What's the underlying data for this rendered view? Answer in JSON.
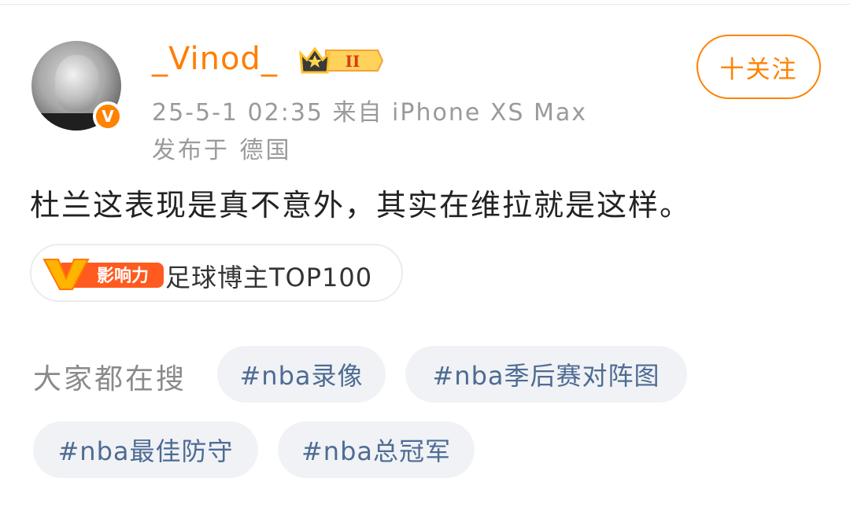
{
  "post": {
    "author": {
      "username": "_Vinod_",
      "verified_badge": "V",
      "rank_badge": "II"
    },
    "meta": "25-5-1 02:35  来自 iPhone XS Max",
    "location": "发布于 德国",
    "follow_label": "十关注",
    "text": "杜兰这表现是真不意外，其实在维拉就是这样。",
    "influence": {
      "logo_text": "影响力",
      "label": "足球博主TOP100"
    }
  },
  "search": {
    "label": "大家都在搜",
    "tags": [
      "#nba录像",
      "#nba季后赛对阵图",
      "#nba最佳防守",
      "#nba总冠军"
    ]
  },
  "colors": {
    "accent": "#ff8200",
    "tag_text": "#4e6b93",
    "tag_bg": "#f0f2f5"
  }
}
